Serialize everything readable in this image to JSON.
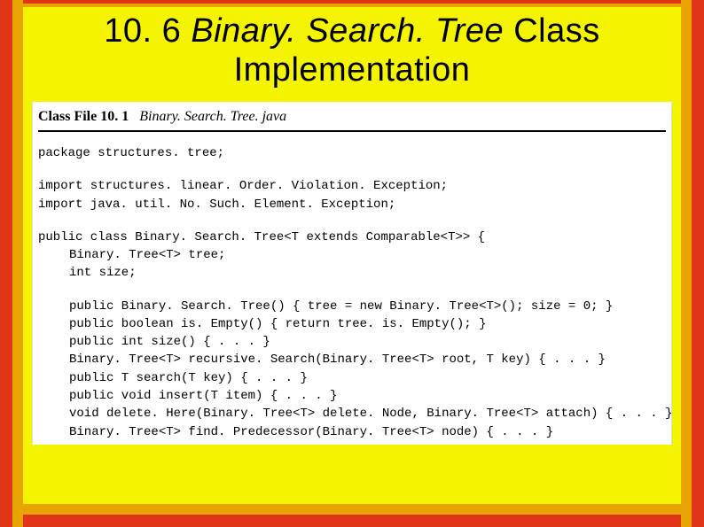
{
  "title": {
    "section": "10. 6",
    "italic": "Binary. Search. Tree",
    "after": " Class",
    "line2": "Implementation"
  },
  "file_header": {
    "label": "Class File 10. 1",
    "filename": "Binary. Search. Tree. java"
  },
  "code": {
    "l1": "package structures. tree;",
    "l2": "import structures. linear. Order. Violation. Exception;",
    "l3": "import java. util. No. Such. Element. Exception;",
    "l4": "public class Binary. Search. Tree<T extends Comparable<T>> {",
    "l5": "Binary. Tree<T> tree;",
    "l6": "int size;",
    "l7": "public Binary. Search. Tree() { tree = new Binary. Tree<T>(); size = 0; }",
    "l8": "public boolean is. Empty() { return tree. is. Empty(); }",
    "l9": "public int size() { . . . }",
    "l10": "Binary. Tree<T> recursive. Search(Binary. Tree<T> root, T key) { . . . }",
    "l11": "public T search(T key) { . . . }",
    "l12": "public void insert(T item) { . . . }",
    "l13": "void delete. Here(Binary. Tree<T> delete. Node, Binary. Tree<T> attach) { . . . }",
    "l14": "Binary. Tree<T> find. Predecessor(Binary. Tree<T> node) { . . . }"
  }
}
